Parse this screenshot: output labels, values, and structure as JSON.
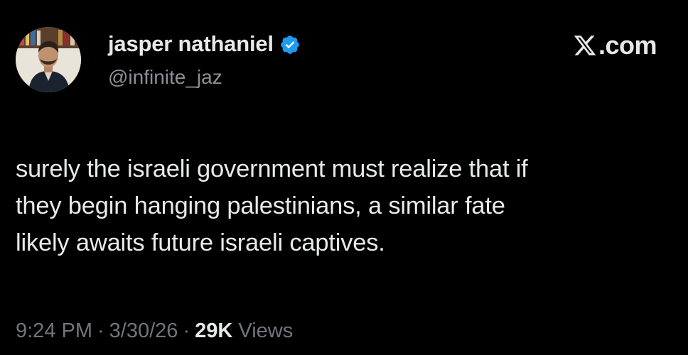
{
  "author": {
    "name": "jasper nathaniel",
    "handle": "@infinite_jaz",
    "verified_icon": "verified-badge-icon",
    "verified_color": "#1d9bf0"
  },
  "brand": {
    "logo_icon": "x-logo-icon",
    "domain": ".com"
  },
  "tweet": {
    "text": "surely the israeli government must realize that if\nthey begin hanging palestinians, a similar fate\nlikely awaits future israeli captives."
  },
  "meta": {
    "time": "9:24 PM",
    "separator": "·",
    "date": "3/30/26",
    "views_count": "29K",
    "views_label": "Views"
  },
  "colors": {
    "background": "#000000",
    "text_primary": "#e7e9ea",
    "text_secondary": "#71767b"
  }
}
